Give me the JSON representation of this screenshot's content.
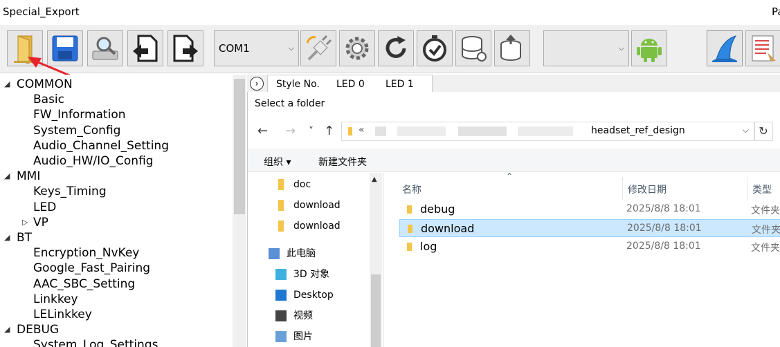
{
  "window": {
    "title": "Special_Export",
    "title_right_cut": "Pa"
  },
  "toolbar": {
    "port_combo": {
      "value": "COM1"
    },
    "second_combo": {
      "value": ""
    }
  },
  "tree": {
    "items": [
      {
        "label": "COMMON",
        "level": 0,
        "arrow": "◢"
      },
      {
        "label": "Basic",
        "level": 1
      },
      {
        "label": "FW_Information",
        "level": 1
      },
      {
        "label": "System_Config",
        "level": 1
      },
      {
        "label": "Audio_Channel_Setting",
        "level": 1
      },
      {
        "label": "Audio_HW/IO_Config",
        "level": 1
      },
      {
        "label": "MMI",
        "level": 0,
        "arrow": "◢"
      },
      {
        "label": "Keys_Timing",
        "level": 1
      },
      {
        "label": "LED",
        "level": 1
      },
      {
        "label": "VP",
        "level": 1,
        "arrow": "▷"
      },
      {
        "label": "BT",
        "level": 0,
        "arrow": "◢"
      },
      {
        "label": "Encryption_NvKey",
        "level": 1
      },
      {
        "label": "Google_Fast_Pairing",
        "level": 1
      },
      {
        "label": "AAC_SBC_Setting",
        "level": 1
      },
      {
        "label": "Linkkey",
        "level": 1
      },
      {
        "label": "LELinkkey",
        "level": 1
      },
      {
        "label": "DEBUG",
        "level": 0,
        "arrow": "◢"
      },
      {
        "label": "System_Log_Settings",
        "level": 1
      }
    ]
  },
  "tabs": {
    "toggle": "›",
    "items": [
      "Style No.",
      "LED 0",
      "LED 1"
    ]
  },
  "dialog": {
    "title": "Select a folder",
    "nav": {
      "back": "←",
      "forward": "→",
      "recent": "˅",
      "up": "↑"
    },
    "address": {
      "chevron": "«",
      "path": "headset_ref_design",
      "dropdown": "⌵",
      "refresh": "↻"
    },
    "commands": {
      "organize": "组织 ▾",
      "new_folder": "新建文件夹"
    },
    "nav_pane": [
      {
        "label": "doc",
        "icon": "folder-icon"
      },
      {
        "label": "download",
        "icon": "folder-icon"
      },
      {
        "label": "download",
        "icon": "folder-icon"
      },
      {
        "label": "此电脑",
        "icon": "computer-icon"
      },
      {
        "label": "3D 对象",
        "icon": "cube-icon"
      },
      {
        "label": "Desktop",
        "icon": "desktop-icon"
      },
      {
        "label": "视频",
        "icon": "video-icon"
      },
      {
        "label": "图片",
        "icon": "picture-icon"
      }
    ],
    "columns": {
      "name": "名称",
      "modified": "修改日期",
      "type": "类型"
    },
    "files": [
      {
        "name": "debug",
        "modified": "2025/8/8 18:01",
        "type": "文件夹",
        "selected": false
      },
      {
        "name": "download",
        "modified": "2025/8/8 18:01",
        "type": "文件夹",
        "selected": true
      },
      {
        "name": "log",
        "modified": "2025/8/8 18:01",
        "type": "文件夹",
        "selected": false
      }
    ]
  },
  "colors": {
    "selection": "#cce8ff",
    "annotation_arrow": "#e8242b",
    "folder": "#f4c54a"
  }
}
